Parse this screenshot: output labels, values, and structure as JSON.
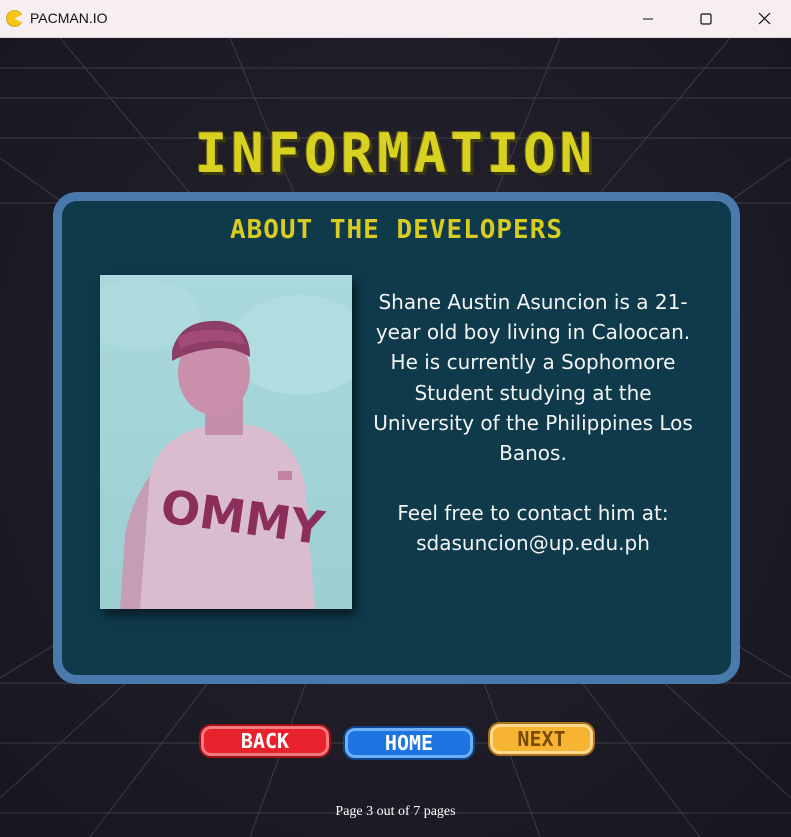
{
  "window": {
    "title": "PACMAN.IO",
    "app_icon": "pacman-icon",
    "controls": [
      "minimize-icon",
      "maximize-icon",
      "close-icon"
    ]
  },
  "page": {
    "heading": "INFORMATION",
    "subheading": "ABOUT THE DEVELOPERS",
    "developer": {
      "photo_caption_shirt_text": "OMMY",
      "bio": "Shane Austin Asuncion is a 21-year old boy living in Caloocan. He is currently a Sophomore Student studying at the University of the Philippines Los Banos.",
      "contact_intro": "Feel free to contact him at:",
      "email": "sdasuncion@up.edu.ph"
    }
  },
  "navigation": {
    "back_label": "BACK",
    "home_label": "HOME",
    "next_label": "NEXT"
  },
  "pagination": {
    "text": "Page 3 out of 7 pages",
    "current": 3,
    "total": 7
  },
  "colors": {
    "heading": "#d9d11f",
    "panel_bg": "#0f3a4b",
    "panel_border": "#4a79ac",
    "back": "#e8222c",
    "home": "#1d73e0",
    "next": "#f6b432"
  }
}
